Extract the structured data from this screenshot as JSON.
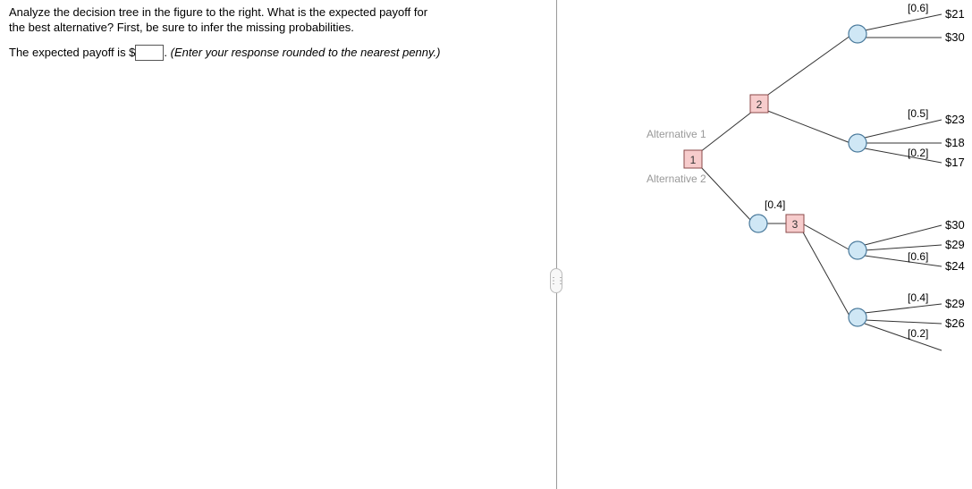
{
  "question": {
    "line1": "Analyze the decision tree in the figure to the right. What is the expected payoff for",
    "line2": "the best alternative? First, be sure to infer the missing probabilities.",
    "answer_prefix": "The expected payoff is $",
    "answer_value": "",
    "answer_suffix": ". ",
    "hint": "(Enter your response rounded to the nearest penny.)"
  },
  "tree": {
    "root": {
      "num": "1"
    },
    "alt1_label": "Alternative 1",
    "alt2_label": "Alternative 2",
    "node2": {
      "num": "2"
    },
    "node3": {
      "num": "3"
    },
    "probs": {
      "topA": "[0.6]",
      "midA": "[0.5]",
      "midB": "[0.2]",
      "alt2_top": "[0.4]",
      "botA": "[0.6]",
      "lowA": "[0.4]",
      "lowB": "[0.2]"
    },
    "payoffs": {
      "p1": "$21",
      "p2": "$30",
      "p3": "$23",
      "p4": "$18",
      "p5": "$17",
      "p6": "$30",
      "p7": "$29",
      "p8": "$24",
      "p9": "$29",
      "p10": "$26"
    }
  },
  "chart_data": {
    "type": "decision-tree",
    "root": {
      "id": 1,
      "kind": "decision",
      "branches": [
        {
          "label": "Alternative 1",
          "to": {
            "id": 2,
            "kind": "decision",
            "branches": [
              {
                "to": {
                  "kind": "chance",
                  "outcomes": [
                    {
                      "prob": 0.6,
                      "payoff": 21
                    },
                    {
                      "prob": null,
                      "payoff": 30
                    }
                  ]
                }
              },
              {
                "to": {
                  "kind": "chance",
                  "outcomes": [
                    {
                      "prob": 0.5,
                      "payoff": 23
                    },
                    {
                      "prob": null,
                      "payoff": 18
                    },
                    {
                      "prob": 0.2,
                      "payoff": 17
                    }
                  ]
                }
              }
            ]
          }
        },
        {
          "label": "Alternative 2",
          "to": {
            "kind": "chance",
            "branches": [
              {
                "prob": 0.4,
                "to": {
                  "id": 3,
                  "kind": "decision",
                  "branches": [
                    {
                      "to": {
                        "kind": "chance",
                        "outcomes": [
                          {
                            "prob": null,
                            "payoff": 30
                          },
                          {
                            "prob": null,
                            "payoff": 29
                          },
                          {
                            "prob": 0.6,
                            "payoff": 24
                          }
                        ]
                      }
                    },
                    {
                      "to": {
                        "kind": "chance",
                        "outcomes": [
                          {
                            "prob": 0.4,
                            "payoff": 29
                          },
                          {
                            "prob": null,
                            "payoff": 26
                          },
                          {
                            "prob": 0.2,
                            "payoff": null
                          }
                        ]
                      }
                    }
                  ]
                }
              }
            ]
          }
        }
      ]
    }
  }
}
